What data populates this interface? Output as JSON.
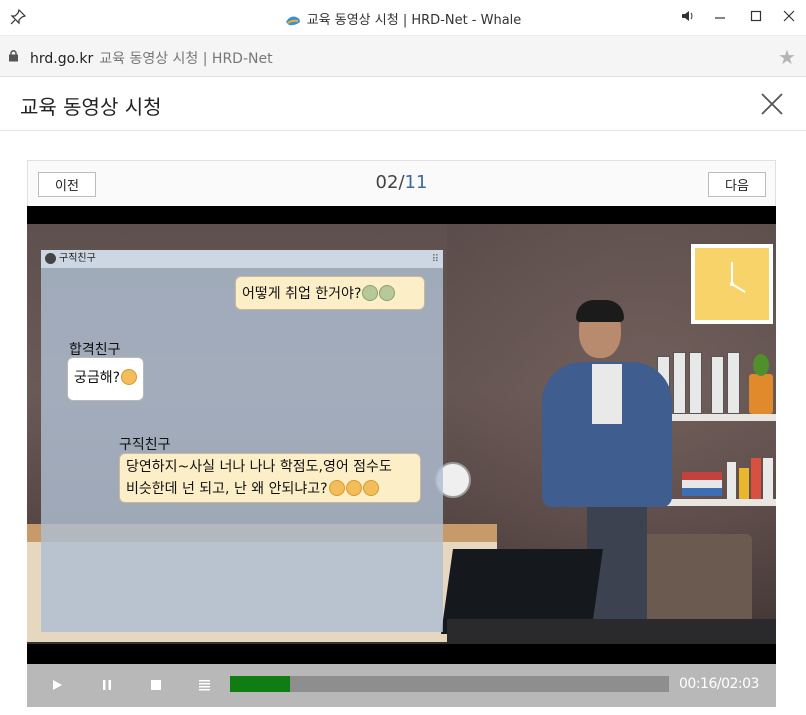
{
  "window": {
    "title": "교육 동영상 시청 | HRD-Net - Whale",
    "controls": [
      "sound",
      "minimize",
      "maximize",
      "close"
    ]
  },
  "address_bar": {
    "domain": "hrd.go.kr",
    "page_title": "교육 동영상 시청 | HRD-Net"
  },
  "dialog": {
    "title": "교육 동영상 시청"
  },
  "nav": {
    "prev_label": "이전",
    "next_label": "다음",
    "current_page": "02",
    "separator": "/",
    "total_pages": "11"
  },
  "video": {
    "chat": {
      "header_name": "구직친구",
      "top_bubble_line1": "어떻게 취업 한거야?",
      "speaker1": "합격친구",
      "bubble1": "궁금해?",
      "speaker2": "구직친구",
      "bubble2_line1": "당연하지~사실 너나 나나 학점도,영어 점수도",
      "bubble2_line2": "비슷한데 넌 되고, 난 왜 안되냐고?"
    }
  },
  "player": {
    "current_time": "00:16",
    "time_separator": "/",
    "total_time": "02:03",
    "progress": 0.137
  },
  "colors": {
    "progress_fill": "#0f7d12",
    "page_total": "#3e67a8",
    "controls_bg": "#b8b8b8"
  }
}
